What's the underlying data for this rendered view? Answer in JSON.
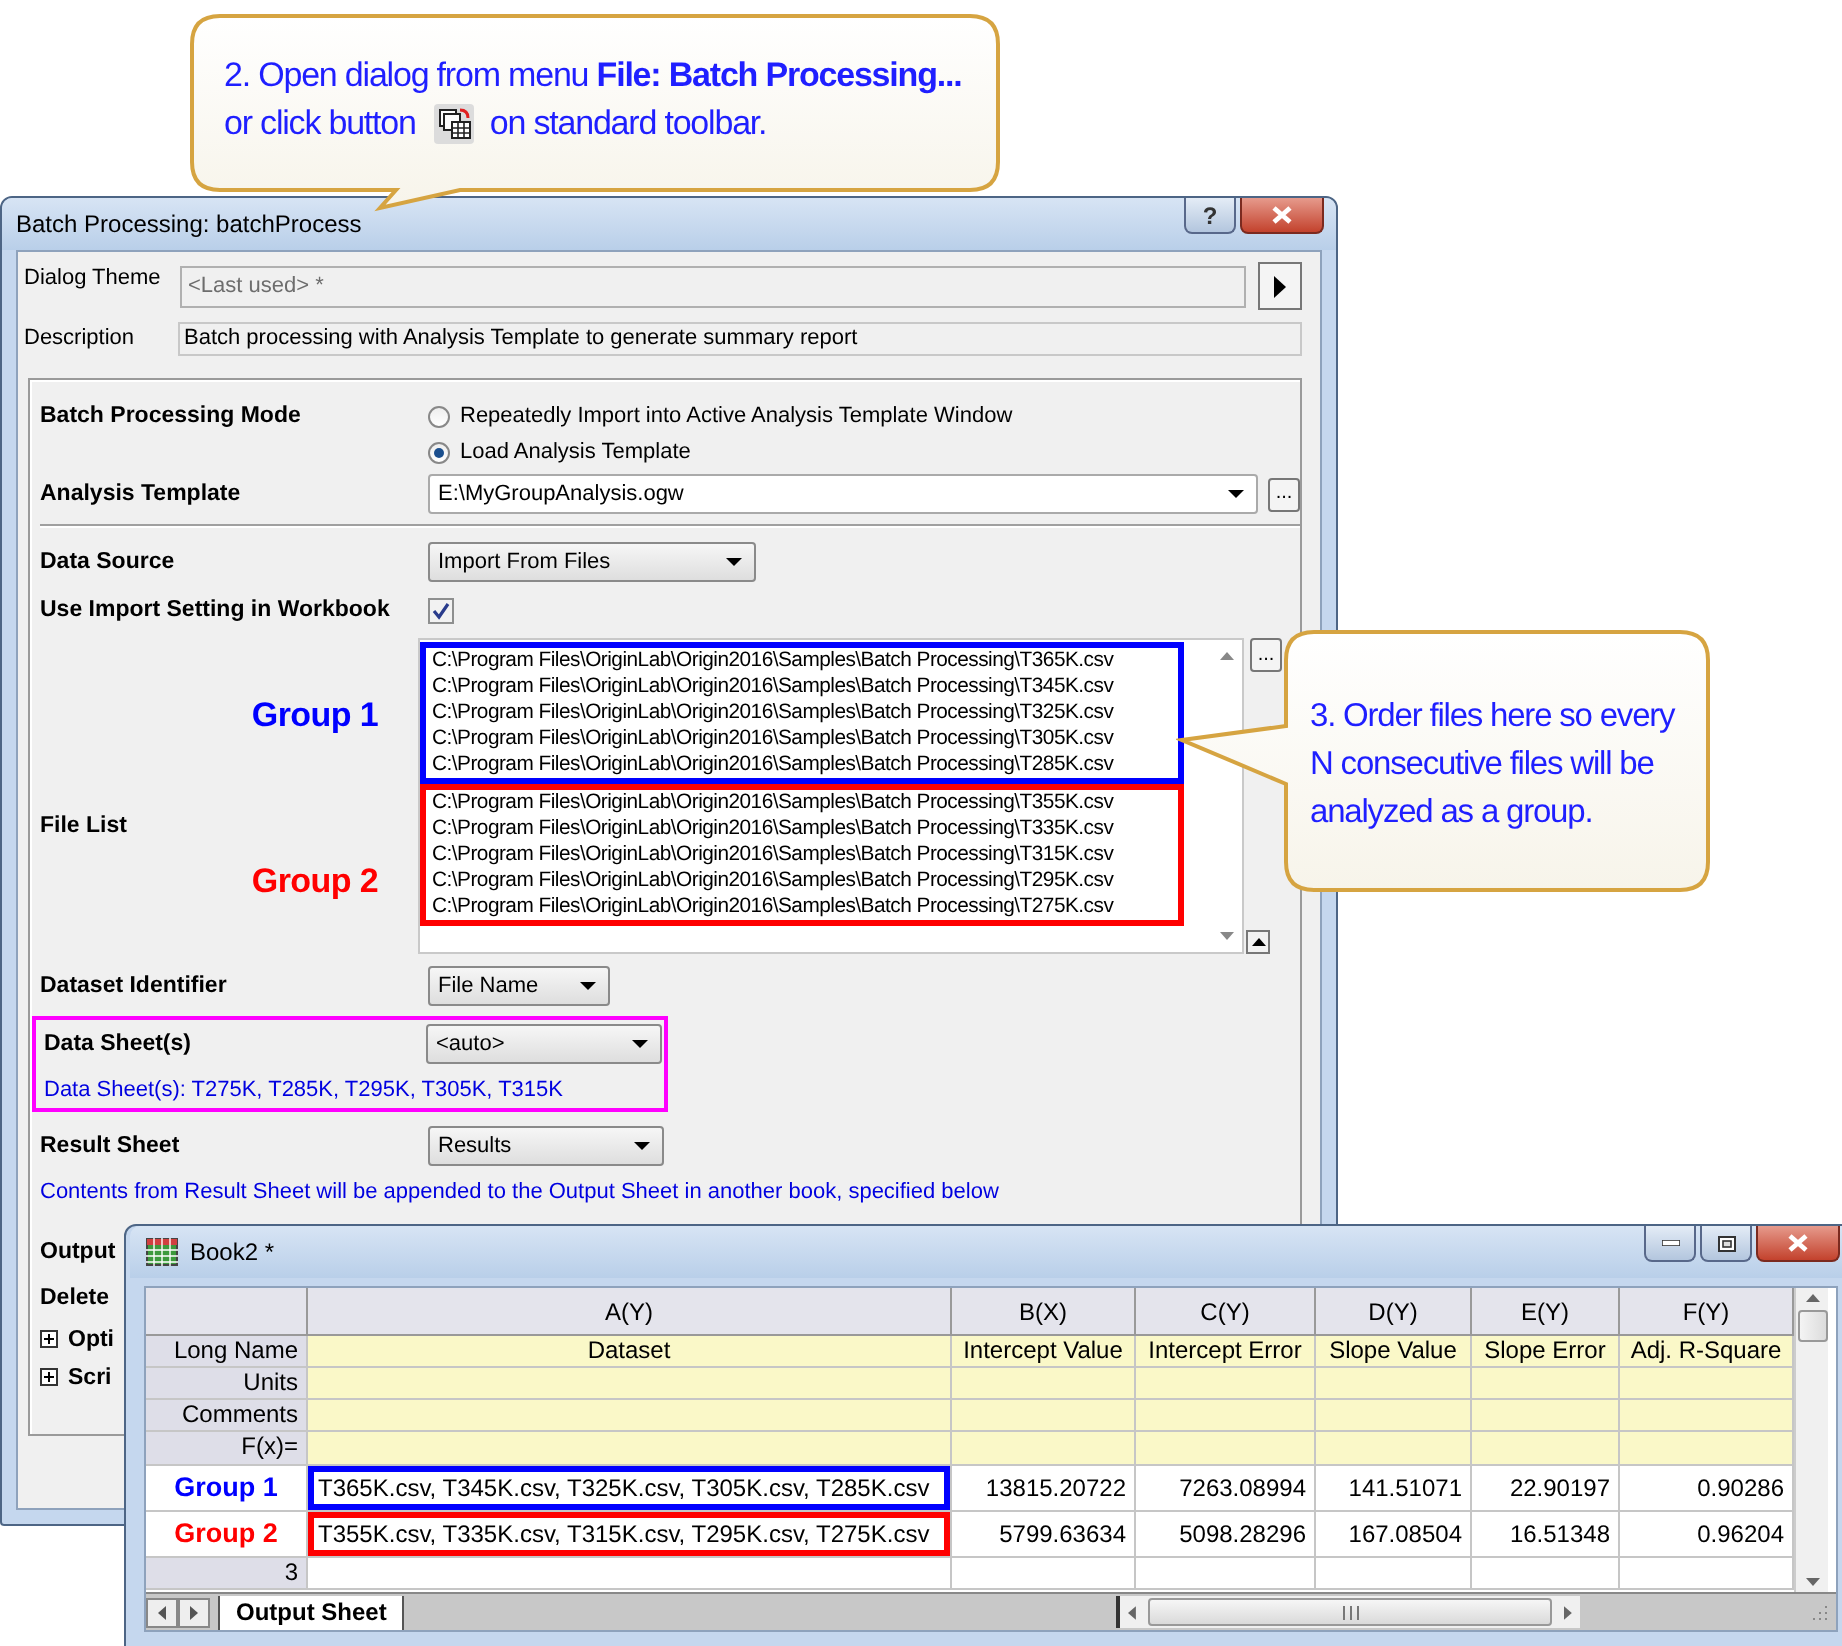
{
  "toolbar_callout": {
    "line1": "2. Open dialog from menu **File: Batch Processing...**",
    "line2_before": "or click button",
    "line2_after": "on standard toolbar."
  },
  "file_callout": {
    "text": "3. Order files here so every N consecutive files will be analyzed as a group."
  },
  "dialog": {
    "title": "Batch Processing: batchProcess",
    "help_button": "?",
    "theme": {
      "label": "Dialog Theme",
      "value": "<Last used> *",
      "disabled": true
    },
    "description": {
      "label": "Description",
      "value": "Batch processing with Analysis Template to generate summary report"
    },
    "mode": {
      "label": "Batch Processing Mode",
      "options": [
        {
          "label": "Repeatedly Import into Active Analysis Template Window",
          "selected": false
        },
        {
          "label": "Load Analysis Template",
          "selected": true
        }
      ]
    },
    "analysis_template": {
      "label": "Analysis Template",
      "value": "E:\\MyGroupAnalysis.ogw",
      "browse": "..."
    },
    "data_source": {
      "label": "Data Source",
      "value": "Import From Files"
    },
    "use_import": {
      "label": "Use Import Setting in Workbook",
      "checked": true
    },
    "file_list": {
      "label": "File List",
      "browse": "...",
      "groups": [
        {
          "label": "Group 1",
          "color": "#0000ff",
          "files": [
            "C:\\Program Files\\OriginLab\\Origin2016\\Samples\\Batch Processing\\T365K.csv",
            "C:\\Program Files\\OriginLab\\Origin2016\\Samples\\Batch Processing\\T345K.csv",
            "C:\\Program Files\\OriginLab\\Origin2016\\Samples\\Batch Processing\\T325K.csv",
            "C:\\Program Files\\OriginLab\\Origin2016\\Samples\\Batch Processing\\T305K.csv",
            "C:\\Program Files\\OriginLab\\Origin2016\\Samples\\Batch Processing\\T285K.csv"
          ]
        },
        {
          "label": "Group 2",
          "color": "#ff0000",
          "files": [
            "C:\\Program Files\\OriginLab\\Origin2016\\Samples\\Batch Processing\\T355K.csv",
            "C:\\Program Files\\OriginLab\\Origin2016\\Samples\\Batch Processing\\T335K.csv",
            "C:\\Program Files\\OriginLab\\Origin2016\\Samples\\Batch Processing\\T315K.csv",
            "C:\\Program Files\\OriginLab\\Origin2016\\Samples\\Batch Processing\\T295K.csv",
            "C:\\Program Files\\OriginLab\\Origin2016\\Samples\\Batch Processing\\T275K.csv"
          ]
        }
      ]
    },
    "dataset_identifier": {
      "label": "Dataset Identifier",
      "value": "File Name"
    },
    "data_sheets": {
      "label": "Data Sheet(s)",
      "value": "<auto>",
      "note": "Data Sheet(s): T275K, T285K, T295K, T305K, T315K",
      "highlighted": true
    },
    "result_sheet": {
      "label": "Result Sheet",
      "value": "Results",
      "note": "Contents from Result Sheet will be appended to the Output Sheet in another book, specified below"
    },
    "more_rows": [
      {
        "kind": "label",
        "text": "Output"
      },
      {
        "kind": "label",
        "text": "Delete"
      },
      {
        "kind": "branch",
        "text": "Opti",
        "expanded": false
      },
      {
        "kind": "branch",
        "text": "Scri",
        "expanded": false
      }
    ]
  },
  "worksheet": {
    "title": "Book2 *",
    "meta_labels": [
      "Long Name",
      "Units",
      "Comments",
      "F(x)="
    ],
    "columns": [
      {
        "name": "A(Y)",
        "long_name": "Dataset"
      },
      {
        "name": "B(X)",
        "long_name": "Intercept Value"
      },
      {
        "name": "C(Y)",
        "long_name": "Intercept Error"
      },
      {
        "name": "D(Y)",
        "long_name": "Slope Value"
      },
      {
        "name": "E(Y)",
        "long_name": "Slope Error"
      },
      {
        "name": "F(Y)",
        "long_name": "Adj. R-Square"
      }
    ],
    "rows": [
      {
        "group_label": "Group 1",
        "color": "#0000ff",
        "cells": [
          "T365K.csv, T345K.csv, T325K.csv, T305K.csv, T285K.csv",
          "13815.20722",
          "7263.08994",
          "141.51071",
          "22.90197",
          "0.90286"
        ]
      },
      {
        "group_label": "Group 2",
        "color": "#ff0000",
        "cells": [
          "T355K.csv, T335K.csv, T315K.csv, T295K.csv, T275K.csv",
          "5799.63634",
          "5098.28296",
          "167.08504",
          "16.51348",
          "0.96204"
        ]
      },
      {
        "header": "3"
      }
    ],
    "sheet_tab": "Output Sheet"
  }
}
